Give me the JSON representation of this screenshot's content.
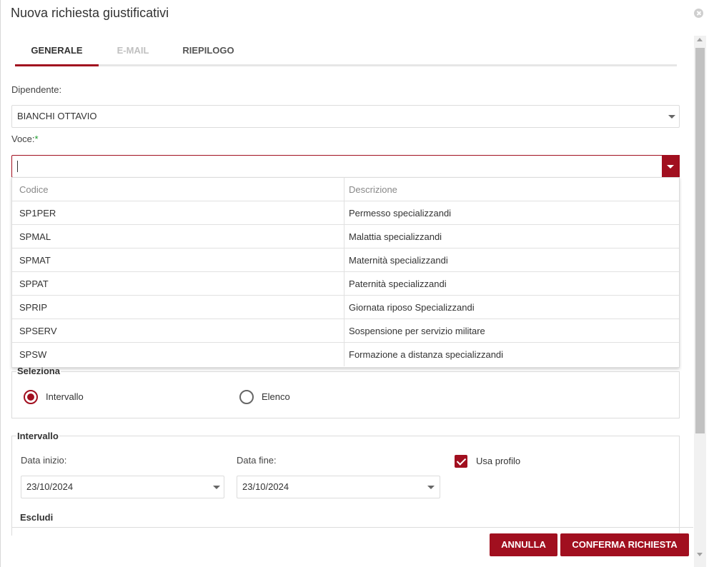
{
  "dialog": {
    "title": "Nuova richiesta giustificativi"
  },
  "tabs": [
    {
      "label": "GENERALE",
      "state": "active"
    },
    {
      "label": "E-MAIL",
      "state": "disabled"
    },
    {
      "label": "RIEPILOGO",
      "state": "normal"
    }
  ],
  "dipendente": {
    "label": "Dipendente:",
    "value": "BIANCHI OTTAVIO"
  },
  "voce": {
    "label": "Voce:",
    "required_mark": "*",
    "value": ""
  },
  "dropdown": {
    "columns": [
      "Codice",
      "Descrizione"
    ],
    "rows": [
      {
        "codice": "SP1PER",
        "descrizione": "Permesso specializzandi"
      },
      {
        "codice": "SPMAL",
        "descrizione": "Malattia specializzandi"
      },
      {
        "codice": "SPMAT",
        "descrizione": "Maternità specializzandi"
      },
      {
        "codice": "SPPAT",
        "descrizione": "Paternità specializzandi"
      },
      {
        "codice": "SPRIP",
        "descrizione": "Giornata riposo Specializzandi"
      },
      {
        "codice": "SPSERV",
        "descrizione": "Sospensione per servizio militare"
      },
      {
        "codice": "SPSW",
        "descrizione": "Formazione a distanza specializzandi"
      }
    ]
  },
  "seleziona": {
    "legend": "Seleziona",
    "options": [
      {
        "label": "Intervallo",
        "checked": true
      },
      {
        "label": "Elenco",
        "checked": false
      }
    ]
  },
  "intervallo": {
    "legend": "Intervallo",
    "data_inizio_label": "Data inizio:",
    "data_inizio_value": "23/10/2024",
    "data_fine_label": "Data fine:",
    "data_fine_value": "23/10/2024",
    "usa_profilo_label": "Usa profilo",
    "usa_profilo_checked": true,
    "escludi_label": "Escludi"
  },
  "footer": {
    "annulla_label": "ANNULLA",
    "conferma_label": "CONFERMA RICHIESTA"
  },
  "colors": {
    "accent": "#a10f1f",
    "required": "#1a9a2a"
  }
}
